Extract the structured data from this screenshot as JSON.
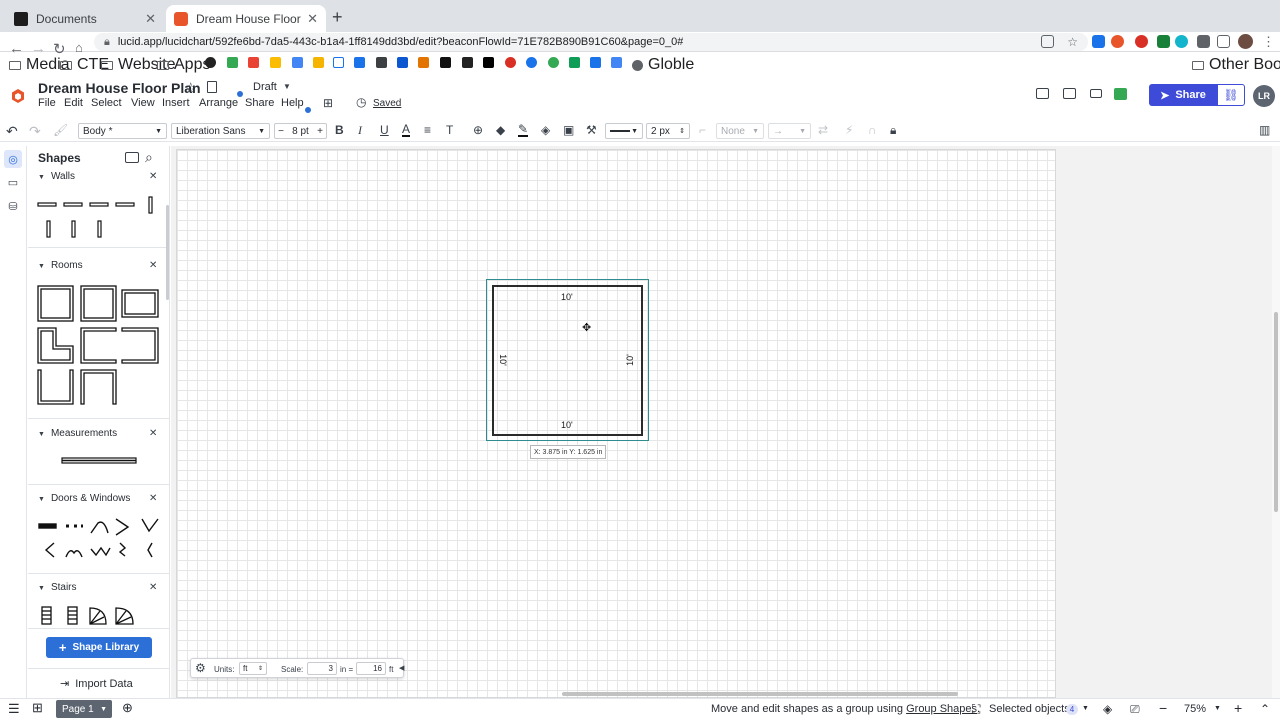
{
  "browser": {
    "tabs": [
      {
        "title": "Documents",
        "favicon_color": "#1d1d1d"
      },
      {
        "title": "Dream House Floor Plan: Lucid",
        "favicon_color": "#e8552a"
      }
    ],
    "url": "lucid.app/lucidchart/592fe6bd-7da5-443c-b1a4-1ff8149dd3bd/edit?beaconFlowId=71E782B890B91C60&page=0_0#",
    "bookmarks": [
      "Media",
      "CTE",
      "Website",
      "Apps",
      "Globle"
    ],
    "other_bookmarks": "Other Bookmarks"
  },
  "doc": {
    "title": "Dream House Floor Plan",
    "status": "Draft",
    "saved": "Saved",
    "menu": [
      "File",
      "Edit",
      "Select",
      "View",
      "Insert",
      "Arrange",
      "Share",
      "Help"
    ],
    "share_label": "Share",
    "avatar_initials": "LR"
  },
  "toolbar": {
    "style": "Body *",
    "font": "Liberation Sans",
    "font_size": "8 pt",
    "line_width": "2 px",
    "endpoint": "None"
  },
  "panel": {
    "title": "Shapes",
    "sections": [
      "Walls",
      "Rooms",
      "Measurements",
      "Doors & Windows",
      "Stairs"
    ],
    "shape_library_label": "Shape Library",
    "import_data_label": "Import Data"
  },
  "canvas": {
    "dims": {
      "top": "10'",
      "bottom": "10'",
      "left": "10'",
      "right": "10'"
    },
    "coord_tip": "X: 3.875 in  Y: 1.625 in"
  },
  "units_bar": {
    "units_label": "Units:",
    "units_value": "ft",
    "scale_label": "Scale:",
    "scale_in_value": "3",
    "scale_in_unit": "in =",
    "scale_ft_value": "16",
    "scale_ft_unit": "ft"
  },
  "footer": {
    "page_label": "Page 1",
    "hint_prefix": "Move and edit shapes as a group using",
    "hint_link": "Group Shapes",
    "hint_suffix": ".",
    "selected_label": "Selected objects",
    "selected_count": "4",
    "zoom": "75%"
  },
  "colors": {
    "accent": "#3d4bd8",
    "selection": "#2e8c8f",
    "shape_library": "#2c6fd6"
  }
}
